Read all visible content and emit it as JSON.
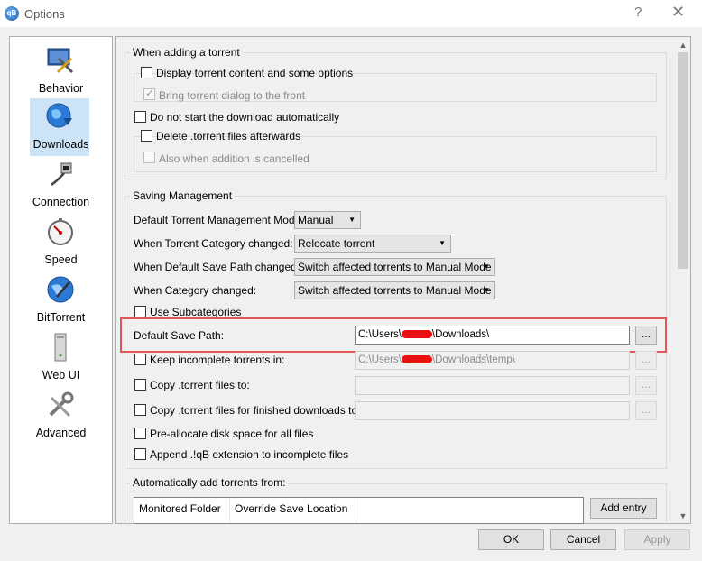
{
  "window": {
    "title": "Options",
    "app_icon_text": "qB",
    "help_glyph": "?",
    "close_glyph": "✕"
  },
  "nav": {
    "items": [
      {
        "label": "Behavior",
        "icon": "behavior-icon"
      },
      {
        "label": "Downloads",
        "icon": "downloads-icon",
        "selected": true
      },
      {
        "label": "Connection",
        "icon": "connection-icon"
      },
      {
        "label": "Speed",
        "icon": "speed-icon"
      },
      {
        "label": "BitTorrent",
        "icon": "bittorrent-icon"
      },
      {
        "label": "Web UI",
        "icon": "webui-icon"
      },
      {
        "label": "Advanced",
        "icon": "advanced-icon"
      }
    ]
  },
  "adding": {
    "title": "When adding a torrent",
    "display_content": "Display torrent content and some options",
    "bring_front": "Bring torrent dialog to the front",
    "no_start": "Do not start the download automatically",
    "delete_files": "Delete .torrent files afterwards",
    "also_cancelled": "Also when addition is cancelled"
  },
  "saving": {
    "title": "Saving Management",
    "rows": [
      {
        "label": "Default Torrent Management Mode:",
        "value": "Manual"
      },
      {
        "label": "When Torrent Category changed:",
        "value": "Relocate torrent"
      },
      {
        "label": "When Default Save Path changed:",
        "value": "Switch affected torrents to Manual Mode"
      },
      {
        "label": "When Category changed:",
        "value": "Switch affected torrents to Manual Mode"
      }
    ],
    "use_subcategories": "Use Subcategories",
    "default_save_path_label": "Default Save Path:",
    "default_save_path_prefix": "C:\\Users\\",
    "default_save_path_suffix": "\\Downloads\\",
    "keep_incomplete_label": "Keep incomplete torrents in:",
    "keep_incomplete_prefix": "C:\\Users\\",
    "keep_incomplete_suffix": "\\Downloads\\temp\\",
    "copy_torrent_label": "Copy .torrent files to:",
    "copy_finished_label": "Copy .torrent files for finished downloads to:",
    "preallocate": "Pre-allocate disk space for all files",
    "append_ext": "Append .!qB extension to incomplete files",
    "browse_label": "..."
  },
  "auto_add": {
    "title": "Automatically add torrents from:",
    "columns": [
      "Monitored Folder",
      "Override Save Location"
    ],
    "add_entry": "Add entry"
  },
  "buttons": {
    "ok": "OK",
    "cancel": "Cancel",
    "apply": "Apply"
  },
  "colors": {
    "highlight": "#e05757",
    "selected_nav": "#cde4f7"
  }
}
